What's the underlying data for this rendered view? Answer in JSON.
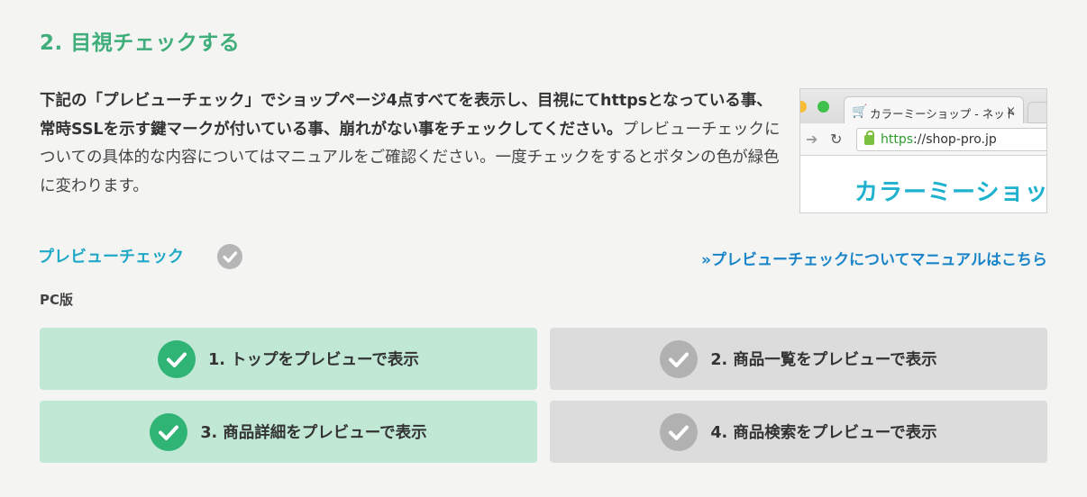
{
  "section": {
    "title": "2. 目視チェックする"
  },
  "description": {
    "bold": "下記の「プレビューチェック」でショップページ4点すべてを表示し、目視にてhttpsとなっている事、常時SSLを示す鍵マークが付いている事、崩れがない事をチェックしてください。",
    "normal": "プレビューチェックについての具体的な内容についてはマニュアルをご確認ください。一度チェックをするとボタンの色が緑色に変わります。"
  },
  "browser_example": {
    "tab_title": "カラーミーショップ - ネット",
    "tab_close": "×",
    "url_scheme": "https",
    "url_rest": "://shop-pro.jp",
    "banner": "カラーミーショップ",
    "colors": {
      "close_dot": "#ff5f57",
      "min_dot": "#febc2e",
      "max_dot": "#28c840"
    }
  },
  "preview": {
    "heading": "プレビューチェック",
    "status_icon": "check-circle-icon",
    "manual_link": "»プレビューチェックについてマニュアルはこちら"
  },
  "pc": {
    "label": "PC版",
    "buttons": [
      {
        "label": "1. トップをプレビューで表示",
        "checked": true
      },
      {
        "label": "2. 商品一覧をプレビューで表示",
        "checked": false
      },
      {
        "label": "3. 商品詳細をプレビューで表示",
        "checked": true
      },
      {
        "label": "4. 商品検索をプレビューで表示",
        "checked": false
      }
    ]
  },
  "colors": {
    "title_green": "#3fae7a",
    "link_blue": "#1a84c9",
    "heading_teal": "#20a9c6",
    "done_bg": "#c0e8d5",
    "done_icon": "#2fb475",
    "todo_bg": "#dcdcdc",
    "todo_icon": "#b1b1b1"
  }
}
